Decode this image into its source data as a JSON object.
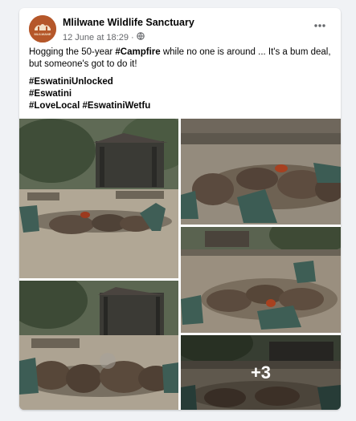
{
  "post": {
    "page_name": "Mlilwane Wildlife Sanctuary",
    "avatar_text": "MLILWANE",
    "date": "12 June at 18:29",
    "separator": "·",
    "privacy_icon": "globe-icon",
    "more_icon": "more-options-icon",
    "text_before": "Hogging the 50-year ",
    "text_hashtag": "#Campfire",
    "text_after": " while no one is around ... It's a bum deal, but someone's got to do it!",
    "hashtags": [
      "#EswatiniUnlocked",
      "#Eswatini",
      "#LoveLocal #EswatiniWetfu"
    ]
  },
  "gallery": {
    "more_count": "+3"
  },
  "colors": {
    "avatar_bg": "#b5572a",
    "text": "#050505",
    "meta": "#65676b"
  }
}
